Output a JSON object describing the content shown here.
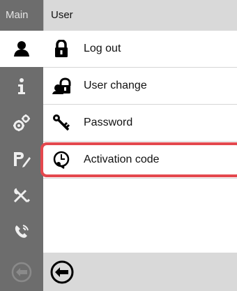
{
  "sidebar": {
    "title": "Main",
    "items": [
      {
        "icon": "user-icon"
      },
      {
        "icon": "info-icon"
      },
      {
        "icon": "settings-gears-icon"
      },
      {
        "icon": "program-edit-icon"
      },
      {
        "icon": "service-tools-icon"
      },
      {
        "icon": "phone-contact-icon"
      }
    ],
    "back_icon": "back-arrow-icon"
  },
  "header": {
    "title": "User"
  },
  "menu": {
    "items": [
      {
        "label": "Log out",
        "icon": "lock-icon"
      },
      {
        "label": "User change",
        "icon": "user-change-icon"
      },
      {
        "label": "Password",
        "icon": "key-icon"
      },
      {
        "label": "Activation code",
        "icon": "activation-code-icon"
      }
    ]
  },
  "bottom": {
    "back_icon": "back-arrow-icon"
  },
  "colors": {
    "highlight": "#e4484e",
    "sidebar": "#6d6d6d",
    "header": "#d9d9d9"
  }
}
